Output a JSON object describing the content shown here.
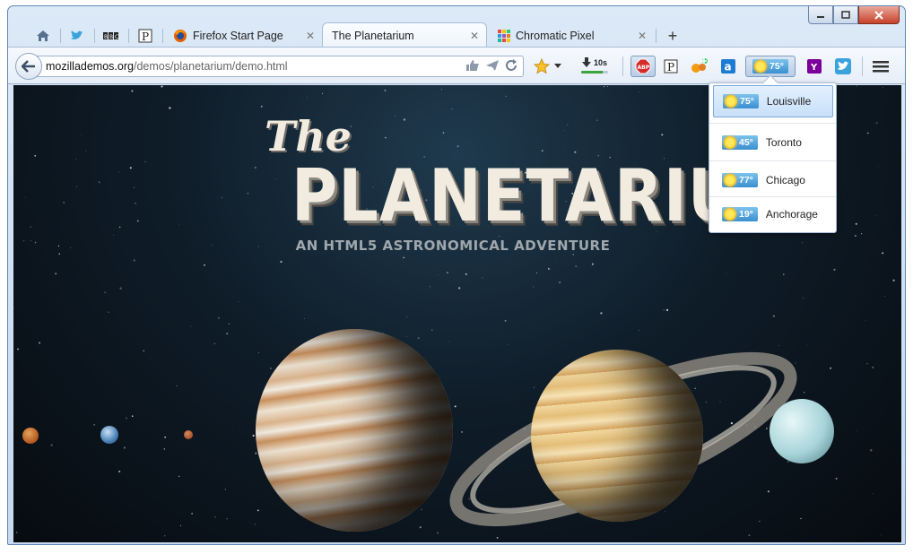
{
  "window": {
    "title": "The Planetarium"
  },
  "tabs": {
    "pinned": [
      "home-icon",
      "twitter-icon",
      "bbc-icon",
      "pocket-icon"
    ],
    "items": [
      {
        "label": "Firefox Start Page",
        "icon": "firefox-icon",
        "active": false
      },
      {
        "label": "The Planetarium",
        "icon": "none",
        "active": true
      },
      {
        "label": "Chromatic Pixel",
        "icon": "chromatic-pixel-icon",
        "active": false
      }
    ],
    "new_tab": "+"
  },
  "navbar": {
    "url_domain": "mozillademos.org",
    "url_path": "/demos/planetarium/demo.html",
    "download": {
      "label": "10s",
      "progress": 0.8
    },
    "weather": {
      "temp": "75°"
    }
  },
  "page": {
    "title_the": "The",
    "title_main": "PLANETARIUM",
    "subtitle": "AN HTML5 ASTRONOMICAL ADVENTURE"
  },
  "weather_dropdown": {
    "items": [
      {
        "temp": "75°",
        "city": "Louisville",
        "selected": true
      },
      {
        "temp": "45°",
        "city": "Toronto",
        "selected": false
      },
      {
        "temp": "77°",
        "city": "Chicago",
        "selected": false
      },
      {
        "temp": "19°",
        "city": "Anchorage",
        "selected": false
      }
    ]
  },
  "colors": {
    "accent": "#3a8fd0",
    "download_fill": "#3fa23c",
    "space": "#0f1d29"
  }
}
